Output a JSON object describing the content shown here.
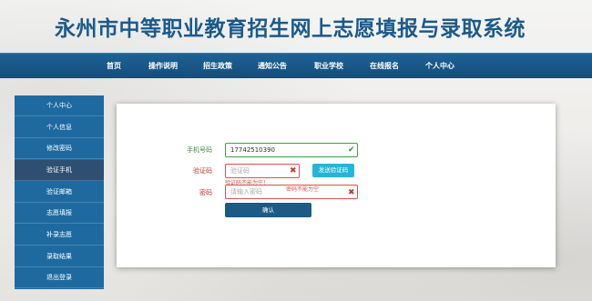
{
  "header": {
    "title": "永州市中等职业教育招生网上志愿填报与录取系统"
  },
  "nav": {
    "items": [
      {
        "label": "首页"
      },
      {
        "label": "操作说明"
      },
      {
        "label": "招生政策"
      },
      {
        "label": "通知公告"
      },
      {
        "label": "职业学校"
      },
      {
        "label": "在线报名"
      },
      {
        "label": "个人中心"
      }
    ]
  },
  "sidebar": {
    "active_index": 3,
    "items": [
      {
        "label": "个人中心"
      },
      {
        "label": "个人信息"
      },
      {
        "label": "修改密码"
      },
      {
        "label": "验证手机"
      },
      {
        "label": "验证邮箱"
      },
      {
        "label": "志愿填报"
      },
      {
        "label": "补录志愿"
      },
      {
        "label": "录取结果"
      },
      {
        "label": "退出登录"
      }
    ]
  },
  "form": {
    "phone": {
      "label": "手机号码",
      "value": "17742510390",
      "status": "ok"
    },
    "code": {
      "label": "验证码",
      "placeholder": "验证码",
      "value": "",
      "error": "验证码不能为空！",
      "status": "error"
    },
    "password": {
      "label": "密码",
      "placeholder": "请输入密码",
      "value": "",
      "error": "密码不能为空",
      "status": "error"
    },
    "send_code_label": "发送验证码",
    "confirm_label": "确认"
  },
  "colors": {
    "brand": "#1a5a8c",
    "nav_bg": "#1d6296",
    "sidebar_bg": "#1e6aa0",
    "sidebar_active": "#2f4f72",
    "ok": "#3c8a3c",
    "error": "#d9534f",
    "send_btn": "#25b5d6",
    "confirm_btn": "#1d5a86"
  },
  "icons": {
    "ok": "check-icon",
    "error": "x-icon"
  }
}
